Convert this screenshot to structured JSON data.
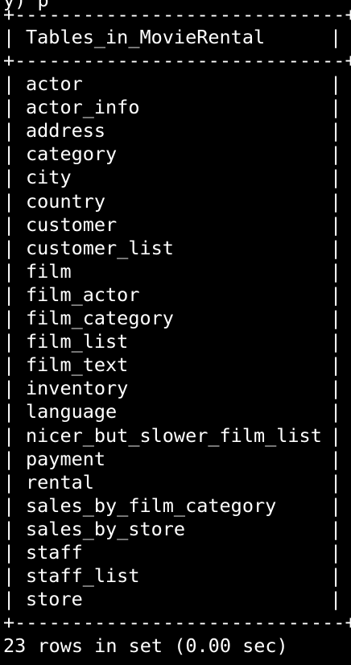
{
  "terminal": {
    "prev_line": "y) p",
    "border_line": "+-----------------------------+",
    "pipe": "|",
    "header": "Tables_in_MovieRental",
    "rows": [
      "actor",
      "actor_info",
      "address",
      "category",
      "city",
      "country",
      "customer",
      "customer_list",
      "film",
      "film_actor",
      "film_category",
      "film_list",
      "film_text",
      "inventory",
      "language",
      "nicer_but_slower_film_list",
      "payment",
      "rental",
      "sales_by_film_category",
      "sales_by_store",
      "staff",
      "staff_list",
      "store"
    ],
    "footer": "23 rows in set (0.00 sec)",
    "colors": {
      "background": "#000000",
      "text": "#ffffff"
    }
  }
}
